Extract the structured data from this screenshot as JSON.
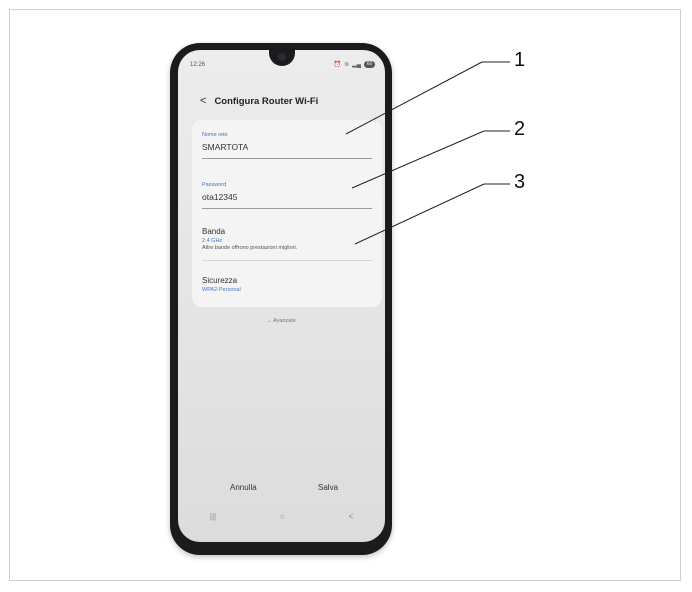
{
  "status_bar": {
    "time": "12:26",
    "battery": "60"
  },
  "header": {
    "title": "Configura Router Wi-Fi"
  },
  "network_name": {
    "label": "Nome rete",
    "value": "SMARTOTA"
  },
  "password": {
    "label": "Password",
    "value": "ota12345"
  },
  "band": {
    "title": "Banda",
    "value": "2.4 GHz",
    "description": "Altre bande offrono prestazioni migliori."
  },
  "security": {
    "title": "Sicurezza",
    "value": "WPA2-Personal"
  },
  "advanced": {
    "label": "Avanzate"
  },
  "footer": {
    "cancel_label": "Annulla",
    "save_label": "Salva"
  },
  "callouts": [
    "1",
    "2",
    "3"
  ],
  "colors": {
    "accent": "#4a72c8",
    "phone_body": "#1b1b1d"
  },
  "icons": {
    "back": "chevron-left-icon",
    "advanced": "chevron-down-icon",
    "nav_recents": "recents-icon",
    "nav_home": "home-icon",
    "nav_back": "nav-back-icon"
  }
}
